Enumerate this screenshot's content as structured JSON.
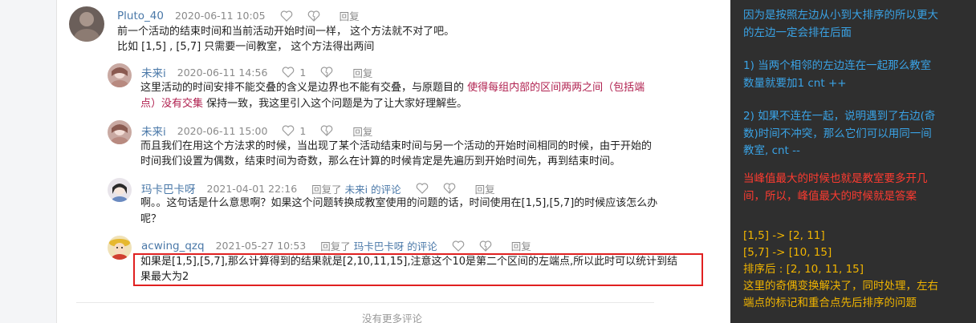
{
  "comments": [
    {
      "user": "Pluto_40",
      "time": "2020-06-11 10:05",
      "like_count": "",
      "reply_label": "回复",
      "lines": [
        "前一个活动的结束时间和当前活动开始时间一样， 这个方法就不对了吧。",
        "比如 [1,5] , [5,7] 只需要一间教室， 这个方法得出两间"
      ]
    },
    {
      "user": "未来i",
      "time": "2020-06-11 14:56",
      "like_count": "1",
      "reply_label": "回复",
      "line1_a": "这里活动的时间安排不能交叠的含义是边界也不能有交叠，与原题目的 ",
      "line1_red": "使得每组内部的区间两两之间（包括端",
      "line2_red": "点）没有交集",
      "line2_b": " 保持一致，我这里引入这个问题是为了让大家好理解些。"
    },
    {
      "user": "未来i",
      "time": "2020-06-11 15:00",
      "like_count": "1",
      "reply_label": "回复",
      "lines": [
        "而且我们在用这个方法求的时候，当出现了某个活动结束时间与另一个活动的开始时间相同的时候，由于开始的",
        "时间我们设置为偶数，结束时间为奇数，那么在计算的时候肯定是先遍历到开始时间先，再到结束时间。"
      ]
    },
    {
      "user": "玛卡巴卡呀",
      "time": "2021-04-01 22:16",
      "reply_prefix": "回复了",
      "reply_target": "未来i 的评论",
      "reply_label": "回复",
      "lines": [
        "啊。。这句话是什么意思啊？如果这个问题转换成教室使用的问题的话，时间使用在[1,5],[5,7]的时候应该怎么办",
        "呢？"
      ]
    },
    {
      "user": "acwing_qzq",
      "time": "2021-05-27 10:53",
      "reply_prefix": "回复了",
      "reply_target": "玛卡巴卡呀 的评论",
      "reply_label": "回复",
      "lines": [
        "如果是[1,5],[5,7],那么计算得到的结果就是[2,10,11,15],注意这个10是第二个区间的左端点,所以此时可以统计到结",
        "果最大为2"
      ]
    }
  ],
  "footer_text": "没有更多评论",
  "notes": {
    "blue_1": [
      "因为是按照左边从小到大排序的所以更大",
      "的左边一定会排在后面"
    ],
    "blue_2": [
      "1) 当两个相邻的左边连在一起那么教室",
      "数量就要加1 cnt ++"
    ],
    "blue_3": [
      "2) 如果不连在一起，说明遇到了右边(奇",
      "数)时间不冲突，那么它们可以用同一间",
      "教室, cnt --"
    ],
    "red_1": [
      "当峰值最大的时候也就是教室要多开几",
      "间，所以，峰值最大的时候就是答案"
    ],
    "yellow": [
      "[1,5] -> [2, 11]",
      "[5,7] -> [10, 15]",
      "排序后 : [2, 10, 11, 15]",
      "这里的奇偶变换解决了，同时处理，左右",
      "端点的标记和重合点先后排序的问题"
    ]
  },
  "colors": {
    "blue": "#3aa3e6",
    "red": "#ff3b30",
    "yellow": "#f0b400",
    "panel": "#2f2f2f",
    "highlight": "#e02020",
    "link": "#4a78a8"
  }
}
